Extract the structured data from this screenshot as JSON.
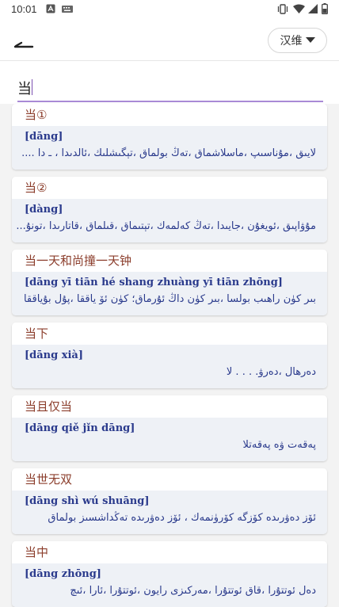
{
  "status_bar": {
    "time": "10:01",
    "icons": [
      "notification-a-icon",
      "keyboard-icon",
      "vibrate-icon",
      "wifi-icon",
      "signal-icon",
      "battery-icon"
    ]
  },
  "app_bar": {
    "back_icon": "back-arrow-icon",
    "language_label": "汉维",
    "language_icon": "dropdown-arrow-icon"
  },
  "search": {
    "value": "当",
    "accent_color": "#a98ad6"
  },
  "colors": {
    "headword": "#8b3d2b",
    "entry_text": "#2a3a8c",
    "entry_background": "#eef1f6"
  },
  "entries": [
    {
      "headword": "当①",
      "pinyin": "[dāng]",
      "definition": "لايىق ،مۇناسىپ ،ماسلاشماق ،تەڭ بولماق ،تېگىشلىك ،ئالدىدا ، ـ دا ...."
    },
    {
      "headword": "当②",
      "pinyin": "[dàng]",
      "definition": "مۇۋاپىق ،ئويغۇن ،جايىدا ،تەڭ كەلمەك ،تېتىماق ،قىلماق ،قاتارىدا ،تونۇ..."
    },
    {
      "headword": "当一天和尚撞一天钟",
      "pinyin": "[dāng yī tiān hé shang zhuàng yī tiān zhōng]",
      "definition": "بىر كۈن راھىب بولسا ،بىر كۈن داڭ ئۇرماق؛ كۈن ئۆ ياققا ،پۇل بۇياققا"
    },
    {
      "headword": "当下",
      "pinyin": "[dāng xià]",
      "definition": "دەرھال ،دەرۋ. . . . لا"
    },
    {
      "headword": "当且仅当",
      "pinyin": "[dāng qiě jǐn dāng]",
      "definition": "پەقەت ۋە پەقەتلا"
    },
    {
      "headword": "当世无双",
      "pinyin": "[dāng shì wú shuāng]",
      "definition": "ئۆز دەۋرىدە كۆزگە كۆرۈنمەك ، ئۆز دەۋرىدە تەڭداشسىز بولماق"
    },
    {
      "headword": "当中",
      "pinyin": "[dāng zhōng]",
      "definition": "دەل ئوتتۇرا ،قاق ئوتتۇرا ،مەركىزى رايون ،ئوتتۇرا ،ئارا ،ئىچ"
    }
  ]
}
